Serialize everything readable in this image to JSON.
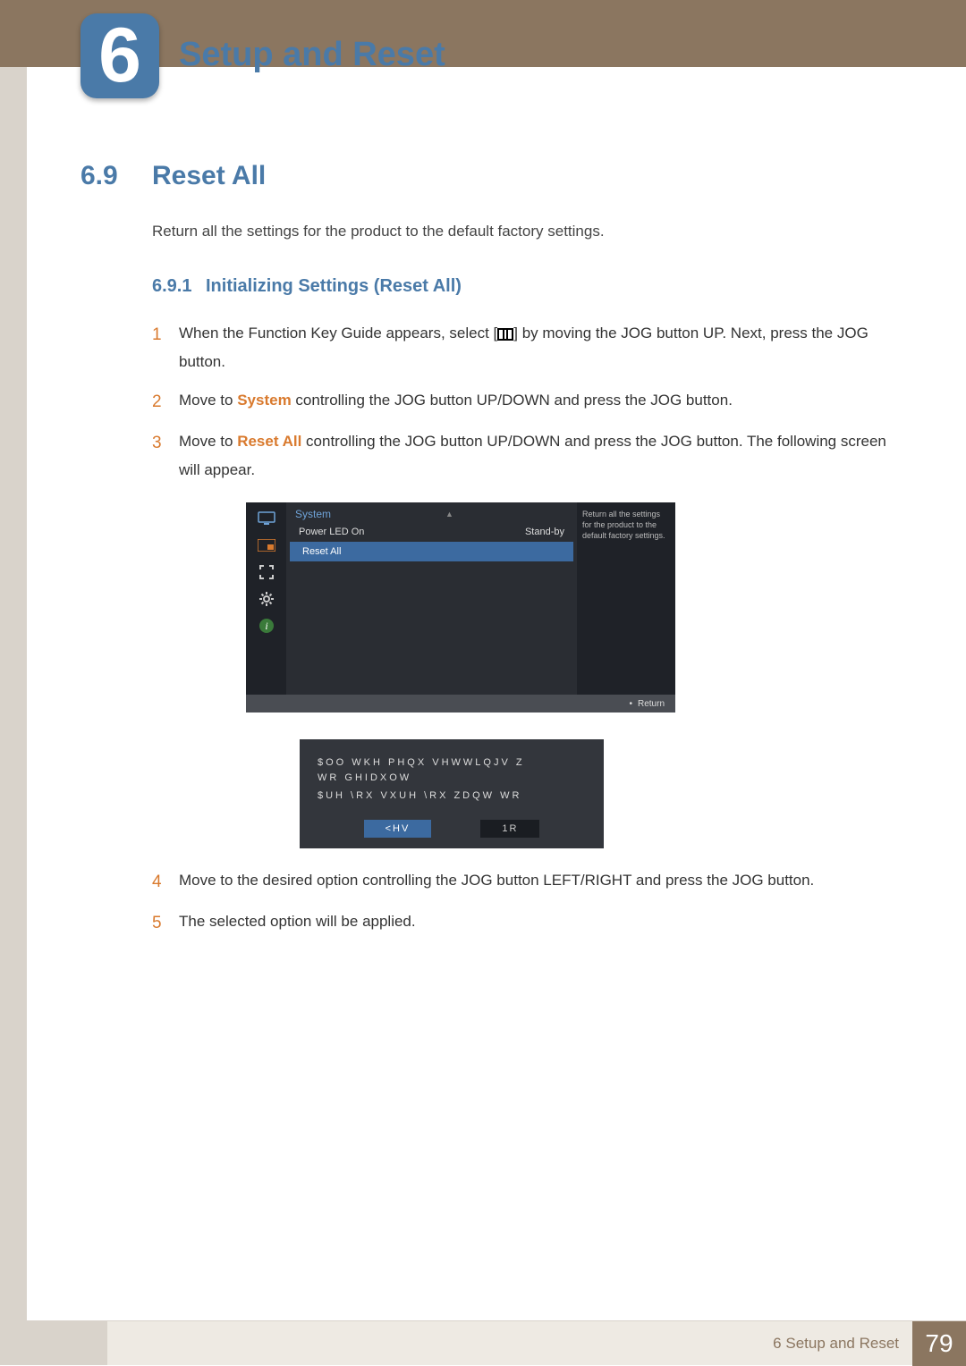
{
  "chapter": {
    "number": "6",
    "title": "Setup and Reset"
  },
  "section": {
    "number": "6.9",
    "title": "Reset All",
    "intro": "Return all the settings for the product to the default factory settings."
  },
  "subsection": {
    "number": "6.9.1",
    "title": "Initializing Settings (Reset All)"
  },
  "steps": {
    "s1": {
      "num": "1",
      "pre": "When the Function Key Guide appears, select [",
      "post": "] by moving the JOG button UP. Next, press the JOG button."
    },
    "s2": {
      "num": "2",
      "pre": "Move to ",
      "hl": "System",
      "post": " controlling the JOG button UP/DOWN and press the JOG button."
    },
    "s3": {
      "num": "3",
      "pre": "Move to ",
      "hl": "Reset All",
      "post": " controlling the JOG button UP/DOWN and press the JOG button. The following screen will appear."
    },
    "s4": {
      "num": "4",
      "text": "Move to the desired option controlling the JOG button LEFT/RIGHT and press the JOG button."
    },
    "s5": {
      "num": "5",
      "text": "The selected option will be applied."
    }
  },
  "osd": {
    "menu_title": "System",
    "row1_label": "Power LED On",
    "row1_value": "Stand-by",
    "row2_label": "Reset All",
    "help_text": "Return all the settings for the product to the default factory settings.",
    "footer_return": "Return",
    "dialog_line1": "$OO WKH PHQX VHWWLQJV Z",
    "dialog_line2": "WR GHIDXOW",
    "dialog_line3": "$UH \\RX VXUH \\RX ZDQW WR",
    "btn_yes": "<HV",
    "btn_no": "1R"
  },
  "footer": {
    "chapter_label": "6 Setup and Reset",
    "page": "79"
  }
}
